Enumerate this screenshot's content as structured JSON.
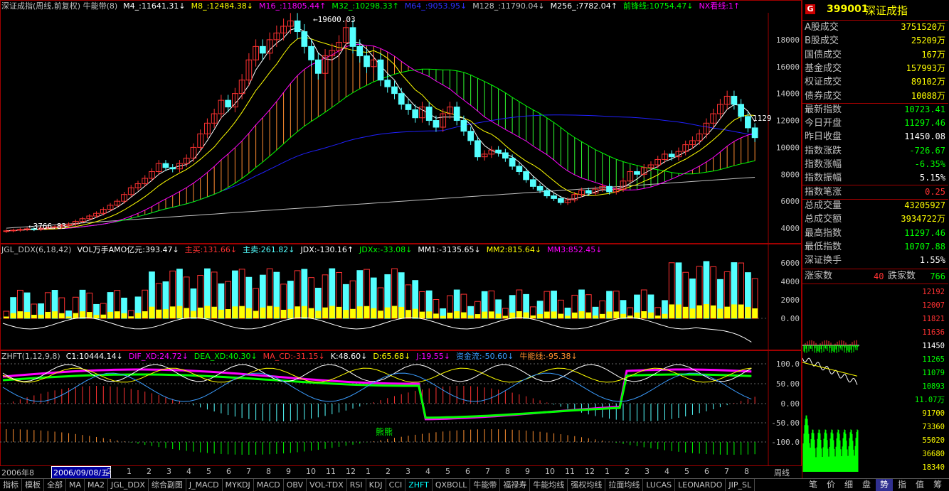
{
  "colors": {
    "up": "#ff3232",
    "down": "#54ffff",
    "yellow": "#ffff00",
    "magenta": "#ff00ff",
    "green": "#00ff00",
    "blue": "#2020ff",
    "white": "#ffffff",
    "grid": "#a00000",
    "label": "#c0c0c0"
  },
  "top_header": [
    {
      "text": "深证成指(周线,前复权) 牛能带(8)",
      "color": "#c0c0c0"
    },
    {
      "text": "M4_:11641.31↓",
      "color": "#ffffff"
    },
    {
      "text": "M8_:12484.38↓",
      "color": "#ffff00"
    },
    {
      "text": "M16_:11805.44↑",
      "color": "#ff00ff"
    },
    {
      "text": "M32_:10298.33↑",
      "color": "#00ff00"
    },
    {
      "text": "M64_:9053.95↓",
      "color": "#3030ff"
    },
    {
      "text": "M128_:11790.04↓",
      "color": "#c0c0c0"
    },
    {
      "text": "M256_:7782.04↑",
      "color": "#ffffff"
    },
    {
      "text": "前锋线:10754.47↓",
      "color": "#00ff00"
    },
    {
      "text": "NX看线:1↑",
      "color": "#ff00ff"
    }
  ],
  "ddx_header": [
    {
      "text": "JGL_DDX(6,18,42)",
      "color": "#c0c0c0"
    },
    {
      "text": "VOL万手AMO亿元:393.47↓",
      "color": "#ffffff"
    },
    {
      "text": "主买:131.66↓",
      "color": "#ff3232"
    },
    {
      "text": "主卖:261.82↓",
      "color": "#54ffff"
    },
    {
      "text": "JDX:-130.16↑",
      "color": "#ffffff"
    },
    {
      "text": "JDXx:-33.08↓",
      "color": "#00ff00"
    },
    {
      "text": "MM1:-3135.65↓",
      "color": "#ffffff"
    },
    {
      "text": "MM2:815.64↓",
      "color": "#ffff00"
    },
    {
      "text": "MM3:852.45↓",
      "color": "#ff00ff"
    }
  ],
  "zhft_header": [
    {
      "text": "ZHFT(1,12,9,8)",
      "color": "#c0c0c0"
    },
    {
      "text": "C1:10444.14↓",
      "color": "#ffffff"
    },
    {
      "text": "DIF_XD:24.72↓",
      "color": "#ff00ff"
    },
    {
      "text": "DEA_XD:40.30↓",
      "color": "#00ff00"
    },
    {
      "text": "MA_CD:-31.15↓",
      "color": "#ff3232"
    },
    {
      "text": "K:48.60↓",
      "color": "#ffffff"
    },
    {
      "text": "D:65.68↓",
      "color": "#ffff00"
    },
    {
      "text": "J:19.55↓",
      "color": "#ff00ff"
    },
    {
      "text": "资金流:-50.60↓",
      "color": "#3b9dff"
    },
    {
      "text": "牛能线:-95.38↓",
      "color": "#ff9030"
    }
  ],
  "annotations": {
    "high": "19600.03",
    "low": "3766.83",
    "right_price": "1129",
    "bear_label": "熊熊"
  },
  "price_axis": [
    "18000",
    "16000",
    "14000",
    "12000",
    "10000",
    "8000",
    "6000",
    "4000"
  ],
  "ddx_axis": [
    "6000",
    "4000",
    "2000",
    "0.00"
  ],
  "zhft_axis": [
    "100.0",
    "50.00",
    "0.00",
    "-50.00",
    "-100.0"
  ],
  "x_axis": {
    "year_left": "2006年8",
    "selected_date": "2006/09/08/五",
    "months": [
      "2",
      "1",
      "2",
      "3",
      "4",
      "5",
      "6",
      "7",
      "8",
      "9",
      "10",
      "11",
      "12",
      "1",
      "2",
      "3",
      "4",
      "5",
      "6",
      "7",
      "8",
      "9",
      "10",
      "11",
      "12",
      "1",
      "2",
      "3",
      "4",
      "5",
      "6",
      "7",
      "8"
    ],
    "period": "周线"
  },
  "bottom_tabs": [
    "指标",
    "模板",
    "全部",
    "MA",
    "MA2",
    "JGL_DDX",
    "综合副图",
    "J_MACD",
    "MYKDJ",
    "MACD",
    "OBV",
    "VOL-TDX",
    "RSI",
    "KDJ",
    "CCI",
    "ZHFT",
    "QXBOLL",
    "牛能带",
    "福禄寿",
    "牛能均线",
    "强权均线",
    "拉面均线",
    "LUCAS",
    "LEONARDO",
    "JIP_SL"
  ],
  "active_tab": "ZHFT",
  "right_tabs": [
    "笔",
    "价",
    "细",
    "盘",
    "势",
    "指",
    "值",
    "筹"
  ],
  "active_right_tab": "势",
  "quote": {
    "badge": "G",
    "code": "399001",
    "name": "深证成指",
    "rows": [
      {
        "label": "A股成交",
        "value": "3751520万",
        "color": "#ffff00"
      },
      {
        "label": "B股成交",
        "value": "25209万",
        "color": "#ffff00"
      },
      {
        "label": "国债成交",
        "value": "167万",
        "color": "#ffff00"
      },
      {
        "label": "基金成交",
        "value": "157993万",
        "color": "#ffff00"
      },
      {
        "label": "权证成交",
        "value": "89102万",
        "color": "#ffff00"
      },
      {
        "label": "债券成交",
        "value": "10088万",
        "color": "#ffff00"
      },
      {
        "label": "最新指数",
        "value": "10723.41",
        "color": "#00ff00"
      },
      {
        "label": "今日开盘",
        "value": "11297.46",
        "color": "#00ff00"
      },
      {
        "label": "昨日收盘",
        "value": "11450.08",
        "color": "#ffffff"
      },
      {
        "label": "指数涨跌",
        "value": "-726.67",
        "color": "#00ff00"
      },
      {
        "label": "指数涨幅",
        "value": "-6.35%",
        "color": "#00ff00"
      },
      {
        "label": "指数振幅",
        "value": "5.15%",
        "color": "#ffffff"
      },
      {
        "label": "指数笔涨",
        "value": "0.25",
        "color": "#ff3232"
      },
      {
        "label": "总成交量",
        "value": "43205927",
        "color": "#ffff00"
      },
      {
        "label": "总成交额",
        "value": "3934722万",
        "color": "#ffff00"
      },
      {
        "label": "最高指数",
        "value": "11297.46",
        "color": "#00ff00"
      },
      {
        "label": "最低指数",
        "value": "10707.88",
        "color": "#00ff00"
      },
      {
        "label": "深证换手",
        "value": "1.55%",
        "color": "#ffffff"
      }
    ],
    "breadth": {
      "up_label": "涨家数",
      "up_value": "40",
      "down_label": "跌家数",
      "down_value": "766"
    }
  },
  "mini_axis": [
    "12192",
    "12007",
    "11821",
    "11636",
    "11450",
    "11265",
    "11079",
    "10893",
    "11.07万",
    "91700",
    "73360",
    "55020",
    "36680",
    "18340"
  ],
  "chart_data": {
    "type": "candlestick",
    "period": "weekly",
    "ylim": [
      3000,
      20000
    ],
    "close": [
      3800,
      3850,
      3900,
      3950,
      3900,
      4000,
      4050,
      4100,
      4200,
      4300,
      4500,
      4700,
      4900,
      5100,
      5400,
      5700,
      6000,
      6500,
      7000,
      7300,
      7700,
      8200,
      8800,
      8500,
      8400,
      8800,
      9200,
      10000,
      11000,
      11800,
      12500,
      13500,
      13000,
      14000,
      15000,
      16500,
      17500,
      17000,
      18000,
      18500,
      19000,
      19400,
      18600,
      17500,
      16500,
      15500,
      16800,
      17200,
      17800,
      18900,
      17500,
      16800,
      16000,
      16500,
      15000,
      14500,
      14000,
      13200,
      12800,
      12200,
      13000,
      12000,
      11500,
      12500,
      13000,
      12000,
      11200,
      10500,
      9300,
      9500,
      9800,
      9600,
      9200,
      8600,
      8200,
      7600,
      7100,
      6800,
      6400,
      6200,
      5900,
      6100,
      6500,
      6800,
      6600,
      6900,
      7100,
      6700,
      6900,
      7500,
      8200,
      8000,
      8500,
      8700,
      9100,
      9500,
      9300,
      9700,
      10200,
      10500,
      11000,
      11800,
      12500,
      13200,
      13800,
      13200,
      12300,
      11450,
      10723
    ]
  }
}
